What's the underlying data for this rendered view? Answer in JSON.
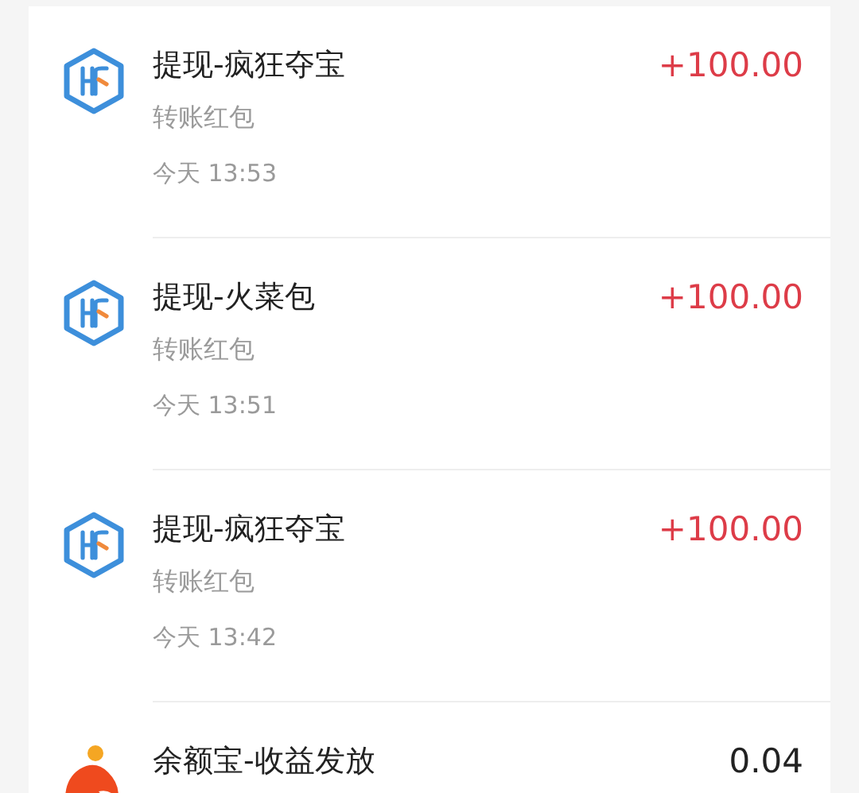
{
  "transactions": [
    {
      "kind": "withdrawal",
      "title": "提现-疯狂夺宝",
      "amount": "+100.00",
      "subtitle": "转账红包",
      "time": "今天 13:53"
    },
    {
      "kind": "withdrawal",
      "title": "提现-火菜包",
      "amount": "+100.00",
      "subtitle": "转账红包",
      "time": "今天 13:51"
    },
    {
      "kind": "withdrawal",
      "title": "提现-疯狂夺宝",
      "amount": "+100.00",
      "subtitle": "转账红包",
      "time": "今天 13:42"
    },
    {
      "kind": "yield",
      "title": "余额宝-收益发放",
      "amount": "0.04"
    }
  ]
}
